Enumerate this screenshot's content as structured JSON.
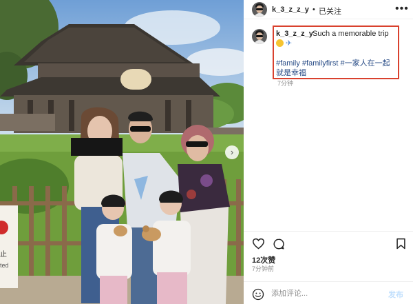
{
  "header": {
    "username": "k_3_z_z_y",
    "separator": "•",
    "follow_status": "已关注",
    "more_icon": "more-horizontal-icon"
  },
  "caption": {
    "username": "k_3_z_z_y",
    "text": "Such a memorable trip",
    "emojis": [
      "smiling-face-icon",
      "airplane-icon"
    ],
    "hashtags_line1": "#family #familyfirst #一家人在一起",
    "hashtags_line2": "就是幸福",
    "time": "7分钟"
  },
  "photo": {
    "sign_text_1": "止",
    "sign_text_2": "ted",
    "carousel_next": "›"
  },
  "actions": {
    "icons": [
      "heart-icon",
      "comment-icon",
      "bookmark-icon"
    ],
    "likes": "12次赞",
    "time_ago": "7分钟前"
  },
  "comment": {
    "placeholder": "添加评论...",
    "post_label": "发布"
  },
  "colors": {
    "highlight_box": "#d9412e",
    "hashtag": "#2a4d87",
    "muted": "#8e8e8e"
  }
}
